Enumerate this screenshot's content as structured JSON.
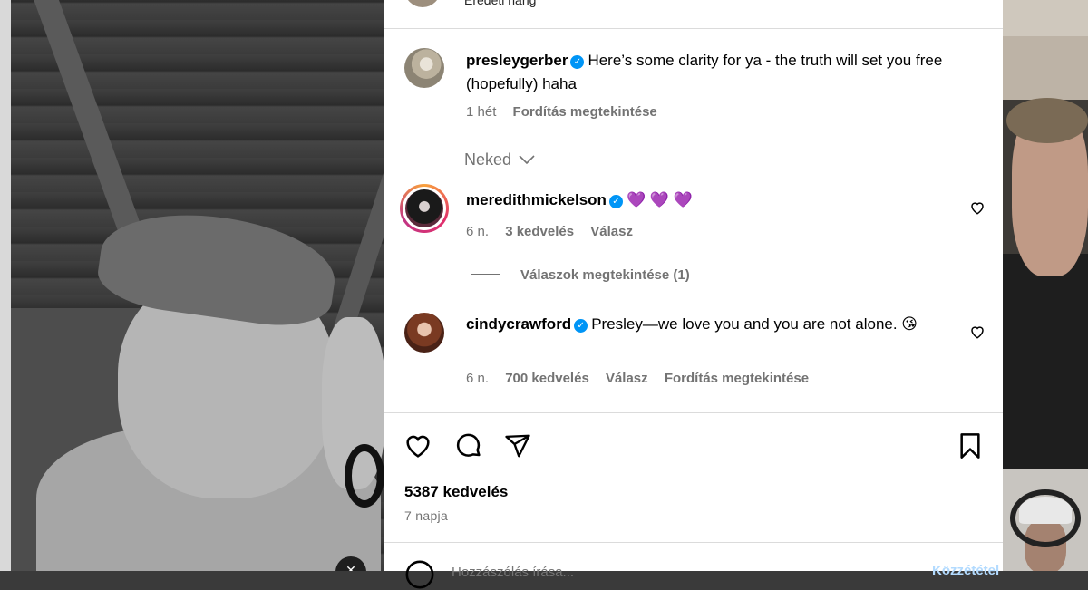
{
  "top_partial": {
    "audio_label": "Eredeti hang"
  },
  "caption": {
    "username": "presleygerber",
    "text": "Here’s some clarity for ya - the truth will set you free (hopefully) haha",
    "time": "1 hét",
    "translate": "Fordítás megtekintése"
  },
  "sort": {
    "label": "Neked"
  },
  "comments": [
    {
      "username": "meredithmickelson",
      "text": "💜 💜 💜",
      "time": "6 n.",
      "likes": "3 kedvelés",
      "reply": "Válasz",
      "view_replies": "Válaszok megtekintése (1)"
    },
    {
      "username": "cindycrawford",
      "text": "Presley—we love you and you are not alone. 😘",
      "time": "6 n.",
      "likes": "700 kedvelés",
      "reply": "Válasz",
      "translate": "Fordítás megtekintése"
    }
  ],
  "actions": {
    "like_icon": "heart-icon",
    "comment_icon": "comment-icon",
    "share_icon": "send-icon",
    "save_icon": "bookmark-icon"
  },
  "stats": {
    "likes": "5387 kedvelés",
    "age": "7 napja"
  },
  "add_comment": {
    "placeholder": "Hozzászólás írása...",
    "post_label": "Közzététel"
  },
  "colors": {
    "verified": "#0095f6",
    "meta": "#737373",
    "divider": "#dbdbdb"
  }
}
